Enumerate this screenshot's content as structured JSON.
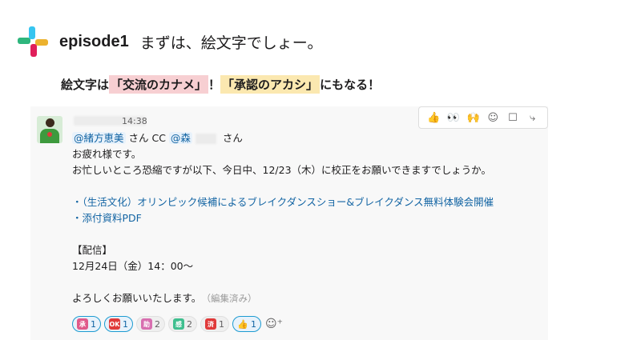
{
  "header": {
    "title": "episode1",
    "subtitle": "まずは、絵文字でしょー。"
  },
  "caption": {
    "prefix": "絵文字は",
    "highlight1": "「交流のカナメ」",
    "mid": "！",
    "highlight2": "「承認のアカシ」",
    "suffix": "にもなる！"
  },
  "colors": {
    "link": "#1264a3",
    "highlight_pink": "#f7cfd2",
    "highlight_yellow": "#fbe8b0"
  },
  "message": {
    "time": "14:38",
    "mention1": "@緒方恵美",
    "san1": " さん CC ",
    "mention2": "@森",
    "san2": "さん",
    "line_greeting": "お疲れ様です。",
    "line_request": "お忙しいところ恐縮ですが以下、今日中、12/23（木）に校正をお願いできますでしょうか。",
    "bullet1": "・（生活文化）オリンピック候補によるブレイクダンスショー&ブレイクダンス無料体験会開催",
    "bullet2": "・添付資料PDF",
    "section_label": "【配信】",
    "date_line": "12月24日（金）14：00〜",
    "closing": "よろしくお願いいたします。",
    "edited": "（編集済み）"
  },
  "toolbar": {
    "icons": [
      "thumbs-up-icon",
      "eyes-icon",
      "raised-hands-icon",
      "add-reaction-icon",
      "reply-thread-icon",
      "forward-icon"
    ]
  },
  "reactions": [
    {
      "icon": "承",
      "count": "1",
      "color": "#e05a8a",
      "active": true
    },
    {
      "icon": "OK",
      "count": "1",
      "color": "#e03a3a",
      "active": true
    },
    {
      "icon": "助",
      "count": "2",
      "color": "#d86fb0",
      "active": false
    },
    {
      "icon": "感",
      "count": "2",
      "color": "#3fbf8f",
      "active": false
    },
    {
      "icon": "済",
      "count": "1",
      "color": "#e03a3a",
      "active": false
    },
    {
      "icon": "👍",
      "count": "1",
      "color": "#f2b531",
      "active": true
    }
  ]
}
